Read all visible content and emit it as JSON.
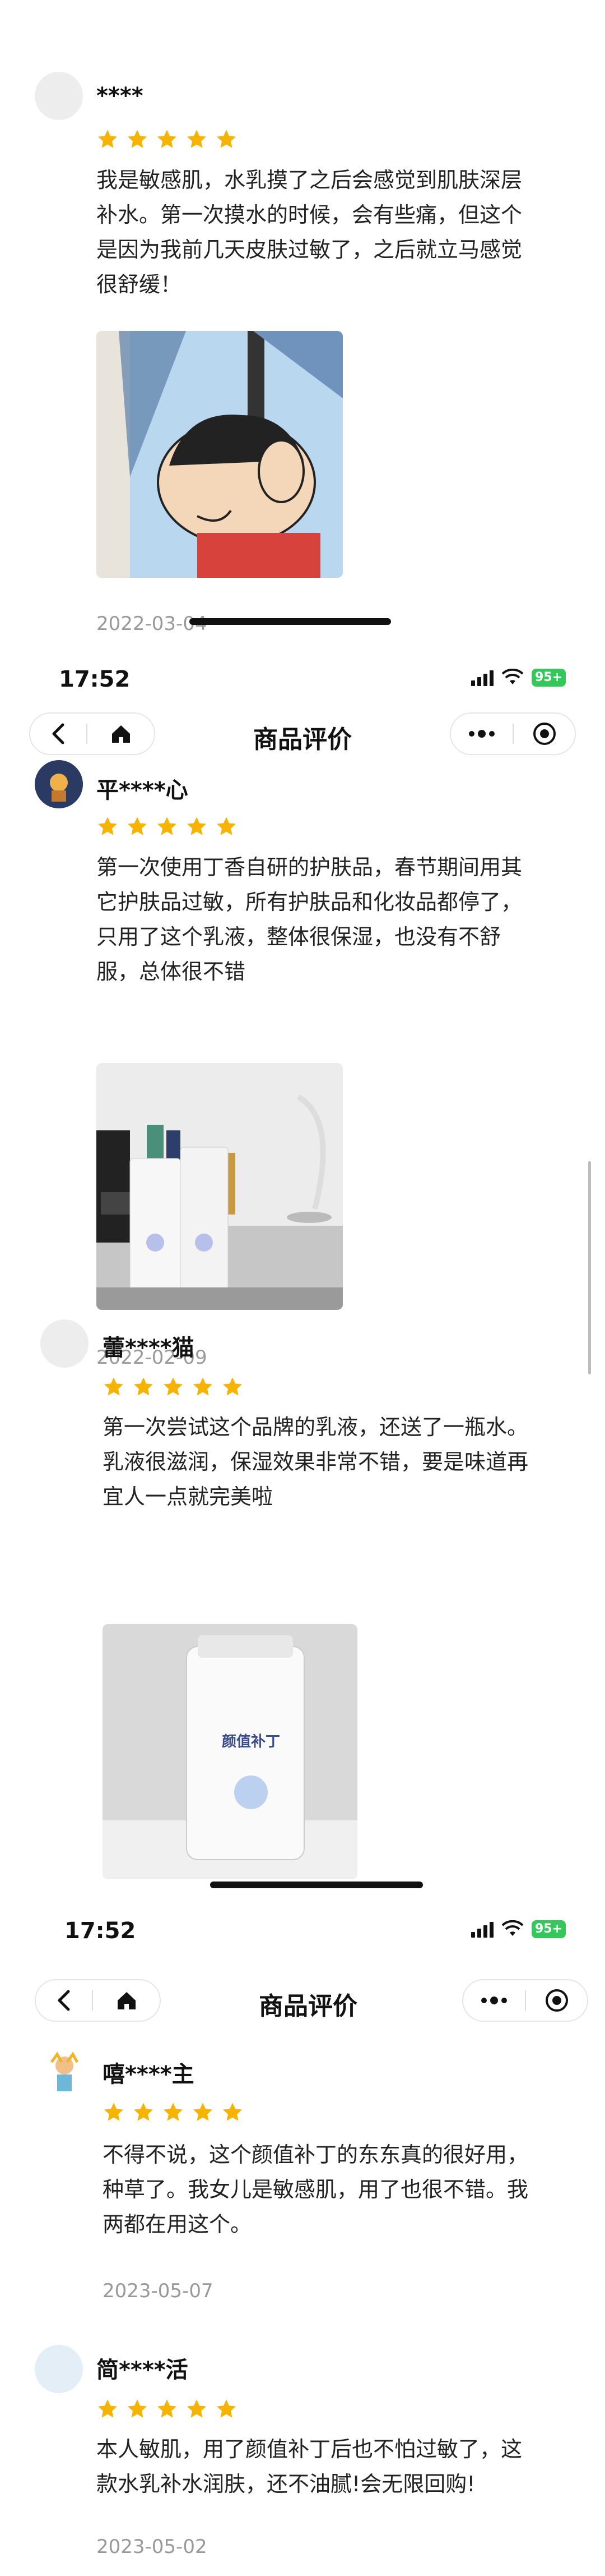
{
  "screens": [
    {
      "status": {
        "time": "17:52",
        "battery": "95+"
      },
      "nav": {
        "title": "商品评价"
      }
    },
    {
      "status": {
        "time": "17:52",
        "battery": "95+"
      },
      "nav": {
        "title": "商品评价"
      }
    }
  ],
  "reviews": [
    {
      "user": "****",
      "rating": 5,
      "text_lines": [
        "我是敏感肌，水乳摸了之后会感觉到肌肤深层",
        "补水。第一次摸水的时候，会有些痛，但这个",
        "是因为我前几天皮肤过敏了，之后就立马感觉",
        "很舒缓！"
      ],
      "date": "2022-03-04"
    },
    {
      "user": "平****心",
      "rating": 5,
      "text_lines": [
        "第一次使用丁香自研的护肤品，春节期间用其",
        "它护肤品过敏，所有护肤品和化妆品都停了，",
        "只用了这个乳液，整体很保湿，也没有不舒",
        "服，总体很不错"
      ],
      "date": "2022-02-09"
    },
    {
      "user": "蕾****猫",
      "rating": 5,
      "text_lines": [
        "第一次尝试这个品牌的乳液，还送了一瓶水。",
        "乳液很滋润，保湿效果非常不错，要是味道再",
        "宜人一点就完美啦"
      ],
      "photo_text": "颜值补丁"
    },
    {
      "user": "嘻****主",
      "rating": 5,
      "text_lines": [
        "不得不说，这个颜值补丁的东东真的很好用，",
        "种草了。我女儿是敏感肌，用了也很不错。我",
        "两都在用这个。"
      ],
      "date": "2023-05-07"
    },
    {
      "user": "简****活",
      "rating": 5,
      "text_lines": [
        "本人敏肌，用了颜值补丁后也不怕过敏了，这",
        "款水乳补水润肤，还不油腻!会无限回购!"
      ],
      "date": "2023-05-02"
    }
  ],
  "icons": {
    "back": "chevron-left-icon",
    "home": "home-icon",
    "more": "more-dots-icon",
    "target": "target-icon",
    "star": "star-icon",
    "wifi": "wifi-icon",
    "signal": "signal-icon",
    "battery": "battery-icon"
  },
  "colors": {
    "star": "#f6b400",
    "battery": "#34c759",
    "date": "#999999"
  }
}
